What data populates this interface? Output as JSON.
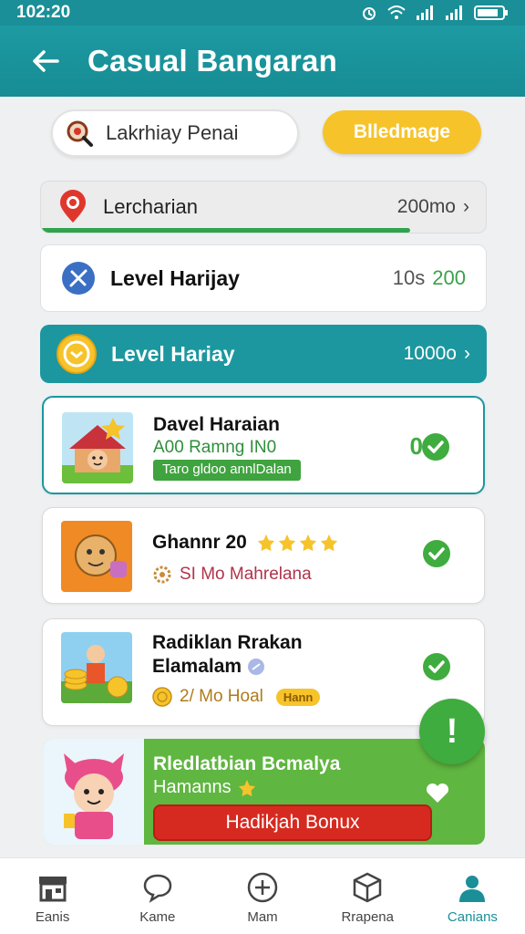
{
  "status": {
    "time": "102:20"
  },
  "header": {
    "title": "Casual Bangaran"
  },
  "search": {
    "placeholder": "Lakrhiay Penai"
  },
  "action_button": {
    "label": "Blledmage"
  },
  "rows": [
    {
      "label": "Lercharian",
      "value": "200mo",
      "progress": 0.83
    },
    {
      "label": "Level Harijay",
      "value_prefix": "10s",
      "value_suffix": "200"
    },
    {
      "label": "Level Hariay",
      "value": "1000o"
    }
  ],
  "cards": [
    {
      "title": "Davel Haraian",
      "subtitle": "A00 Ramng IN0",
      "tag": "Taro gldoo annlDalan",
      "count": "0"
    },
    {
      "title": "Ghannr 20",
      "subtitle": "SI Mo Mahrelana"
    },
    {
      "title": "Radiklan Rrakan",
      "title2": "Elamalam",
      "subtitle": "2/ Mo Hoal",
      "badge": "Hann"
    }
  ],
  "promo": {
    "title": "Rledlatbian Bcmalya",
    "subtitle": "Hamanns",
    "button": "Hadikjah Bonux"
  },
  "fab": {
    "label": "!"
  },
  "nav": [
    {
      "label": "Eanis"
    },
    {
      "label": "Kame"
    },
    {
      "label": "Mam"
    },
    {
      "label": "Rrapena"
    },
    {
      "label": "Canians"
    }
  ],
  "colors": {
    "teal": "#1c979f",
    "green": "#3fac3f",
    "yellow": "#f6c32a",
    "red": "#d62a20"
  }
}
